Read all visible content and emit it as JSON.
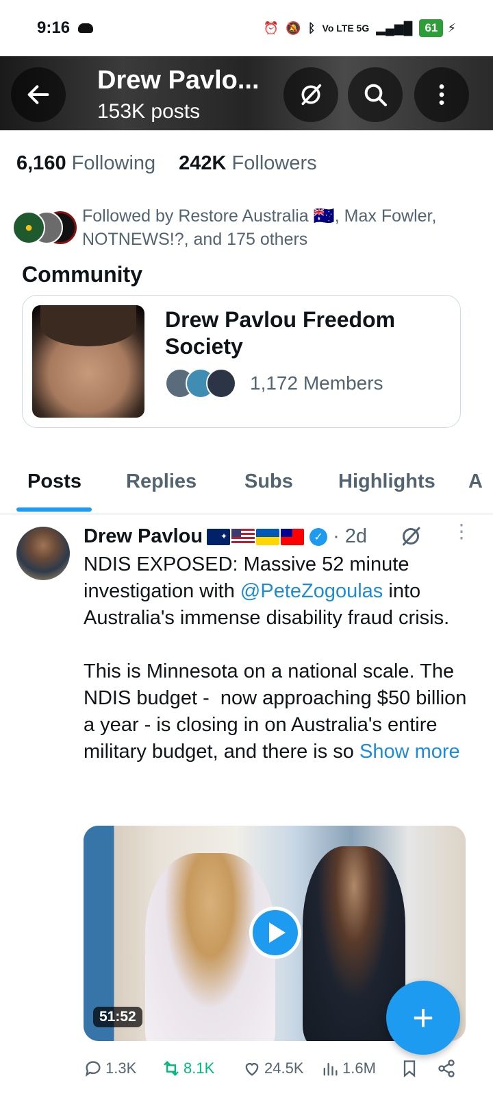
{
  "status_bar": {
    "time": "9:16",
    "network": "Vo LTE 5G",
    "battery": "61"
  },
  "header": {
    "title": "Drew Pavlo...",
    "posts_count": "153K posts"
  },
  "profile": {
    "following_count": "6,160",
    "following_label": "Following",
    "followers_count": "242K",
    "followers_label": "Followers",
    "followed_by": "Followed by Restore Australia 🇦🇺, Max Fowler, NOTNEWS!?, and 175 others"
  },
  "community": {
    "heading": "Community",
    "name": "Drew Pavlou Freedom Society",
    "members": "1,172 Members"
  },
  "tabs": [
    {
      "label": "Posts"
    },
    {
      "label": "Replies"
    },
    {
      "label": "Subs"
    },
    {
      "label": "Highlights"
    },
    {
      "label": "A"
    }
  ],
  "post": {
    "author": "Drew Pavlou",
    "time": "· 2d",
    "text_part1": "NDIS EXPOSED: Massive 52 minute investigation with ",
    "mention": "@PeteZogoulas",
    "text_part2": " into Australia's immense disability fraud crisis.\n\nThis is Minnesota on a national scale. The NDIS budget -  now approaching $50 billion a year - is closing in on Australia's entire military budget, and there is so ",
    "show_more": "Show more",
    "video_duration": "51:52",
    "replies": "1.3K",
    "reposts": "8.1K",
    "likes": "24.5K",
    "views": "1.6M"
  },
  "colors": {
    "accent": "#1d9bf0",
    "repost_green": "#00ba7c",
    "secondary_text": "#536471"
  },
  "fab_label": "+"
}
